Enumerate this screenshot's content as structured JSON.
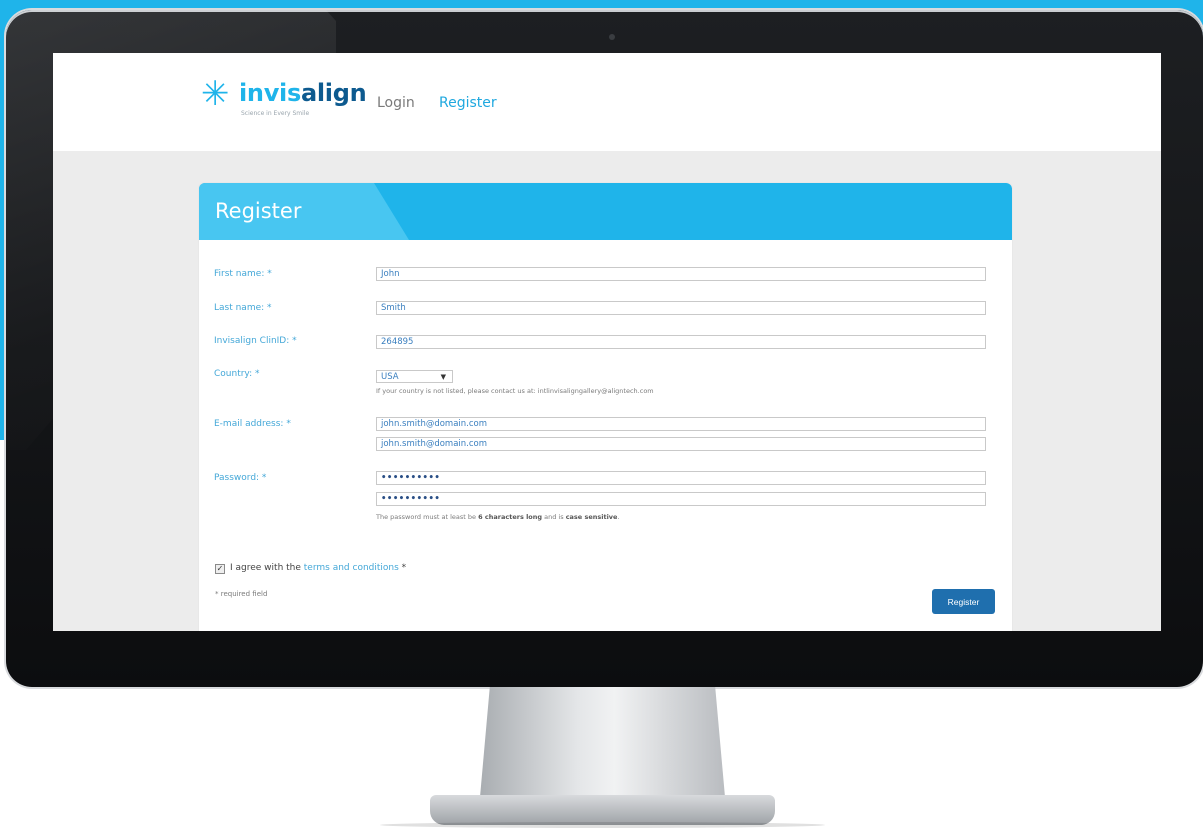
{
  "brand": {
    "name_light": "invis",
    "name_bold": "align",
    "tagline": "Science in Every Smile",
    "star_glyph": "✳",
    "color": "#1fb4ea"
  },
  "nav": {
    "login": "Login",
    "register": "Register"
  },
  "form": {
    "title": "Register",
    "first_name": {
      "label": "First name: *",
      "value": "John"
    },
    "last_name": {
      "label": "Last name: *",
      "value": "Smith"
    },
    "clinid": {
      "label": "Invisalign ClinID: *",
      "value": "264895"
    },
    "country": {
      "label": "Country: *",
      "value": "USA",
      "hint": "If your country is not listed, please contact us at: intlinvisaligngallery@aligntech.com"
    },
    "email": {
      "label": "E-mail address: *",
      "value": "john.smith@domain.com",
      "confirm_value": "john.smith@domain.com"
    },
    "password": {
      "label": "Password: *",
      "value": "••••••••••",
      "confirm_value": "••••••••••",
      "hint_prefix": "The password must at least be ",
      "hint_bold1": "6 characters long",
      "hint_mid": " and is ",
      "hint_bold2": "case sensitive",
      "hint_suffix": "."
    },
    "agree": {
      "checked_glyph": "✓",
      "prefix": "I agree with the ",
      "link": "terms and conditions",
      "suffix": " *"
    },
    "required_note": "* required field",
    "submit": "Register"
  }
}
